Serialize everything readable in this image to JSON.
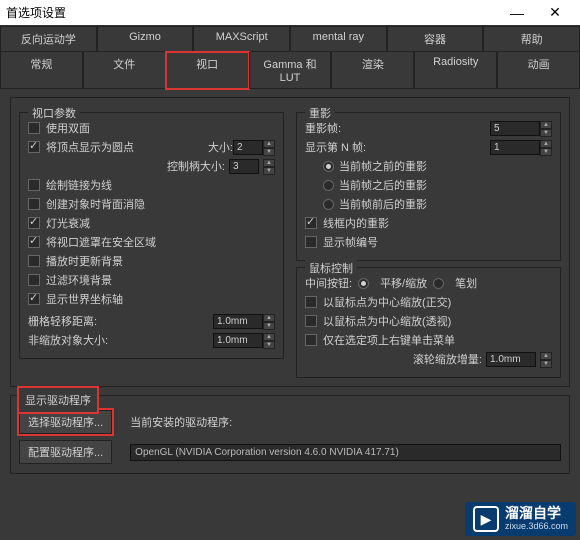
{
  "window": {
    "title": "首选项设置"
  },
  "tabs_row1": [
    "反向运动学",
    "Gizmo",
    "MAXScript",
    "mental ray",
    "容器",
    "帮助"
  ],
  "tabs_row2": [
    "常规",
    "文件",
    "视口",
    "Gamma 和 LUT",
    "渲染",
    "Radiosity",
    "动画"
  ],
  "viewport_params": {
    "legend": "视口参数",
    "use_dual": "使用双面",
    "show_vertex_as_dot": "将顶点显示为圆点",
    "size_label": "大小:",
    "size_value": "2",
    "handle_size_label": "控制柄大小:",
    "handle_size_value": "3",
    "draw_links": "绘制链接为线",
    "bg_on_create": "创建对象时背面消隐",
    "light_atten": "灯光衰减",
    "safe_frame": "将视口遮罩在安全区域",
    "update_bg_play": "播放时更新背景",
    "filter_env_bg": "过滤环境背景",
    "show_world_axis": "显示世界坐标轴",
    "grid_dist_label": "栅格轻移距离:",
    "grid_dist_value": "1.0mm",
    "nonscale_size_label": "非缩放对象大小:",
    "nonscale_size_value": "1.0mm"
  },
  "ghosting": {
    "legend": "重影",
    "frames_label": "重影帧:",
    "frames_value": "5",
    "nth_label": "显示第 N 帧:",
    "nth_value": "1",
    "before": "当前帧之前的重影",
    "after": "当前帧之后的重影",
    "both": "当前帧前后的重影",
    "wireframe": "线框内的重影",
    "show_num": "显示帧编号"
  },
  "mouse": {
    "legend": "鼠标控制",
    "mmb_label": "中间按钮:",
    "pan_zoom": "平移/缩放",
    "stroke": "笔划",
    "center_ortho": "以鼠标点为中心缩放(正交)",
    "center_persp": "以鼠标点为中心缩放(透视)",
    "rclick_menu": "仅在选定项上右键单击菜单",
    "wheel_label": "滚轮缩放增量:",
    "wheel_value": "1.0mm"
  },
  "driver": {
    "legend": "显示驱动程序",
    "choose": "选择驱动程序...",
    "current_label": "当前安装的驱动程序:",
    "config": "配置驱动程序...",
    "current_value": "OpenGL (NVIDIA Corporation version 4.6.0 NVIDIA 417.71)"
  },
  "watermark": {
    "big": "溜溜自学",
    "small": "zixue.3d66.com"
  }
}
